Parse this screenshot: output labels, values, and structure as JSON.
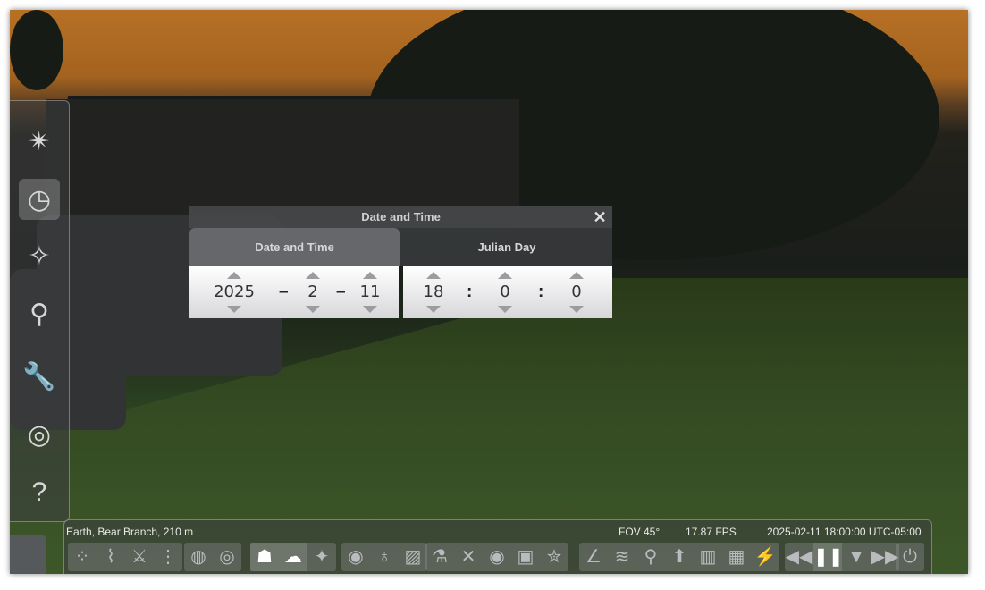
{
  "left_toolbar": {
    "items": [
      {
        "name": "sky-and-viewing-options-icon",
        "glyph": "✴"
      },
      {
        "name": "date-time-icon",
        "glyph": "◷",
        "active": true
      },
      {
        "name": "astronomical-calculations-icon",
        "glyph": "✧"
      },
      {
        "name": "search-icon",
        "glyph": "⚲"
      },
      {
        "name": "configuration-icon",
        "glyph": "🔧"
      },
      {
        "name": "observatory-icon",
        "glyph": "◎"
      },
      {
        "name": "help-icon",
        "glyph": "?"
      }
    ]
  },
  "dialog": {
    "title": "Date and Time",
    "tabs": {
      "date_time": "Date and Time",
      "julian_day": "Julian Day"
    },
    "date": {
      "year": "2025",
      "month": "2",
      "day": "11",
      "sep": "–"
    },
    "time": {
      "hour": "18",
      "minute": "0",
      "second": "0",
      "sep": ":"
    }
  },
  "status_bar": {
    "location": "Earth, Bear Branch, 210 m",
    "fov": "FOV 45°",
    "fps": "17.87 FPS",
    "datetime": "2025-02-11 18:00:00 UTC-05:00"
  },
  "bottom_toolbar": {
    "groups": [
      [
        "⁘",
        "⌇",
        "⚔",
        "⋮"
      ],
      [
        "◍",
        "◎"
      ],
      [
        "☗",
        "☁",
        "✦"
      ],
      [
        "◉",
        "♁",
        "▨"
      ],
      [
        "⚗",
        "✕",
        "◉",
        "▣",
        "✮"
      ],
      [
        "∠",
        "≋",
        "⚲",
        "⬆",
        "▥",
        "▦",
        "⚡"
      ],
      [
        "◀◀",
        "❚❚",
        "▼",
        "▶▶"
      ],
      [
        "⏻"
      ]
    ]
  }
}
